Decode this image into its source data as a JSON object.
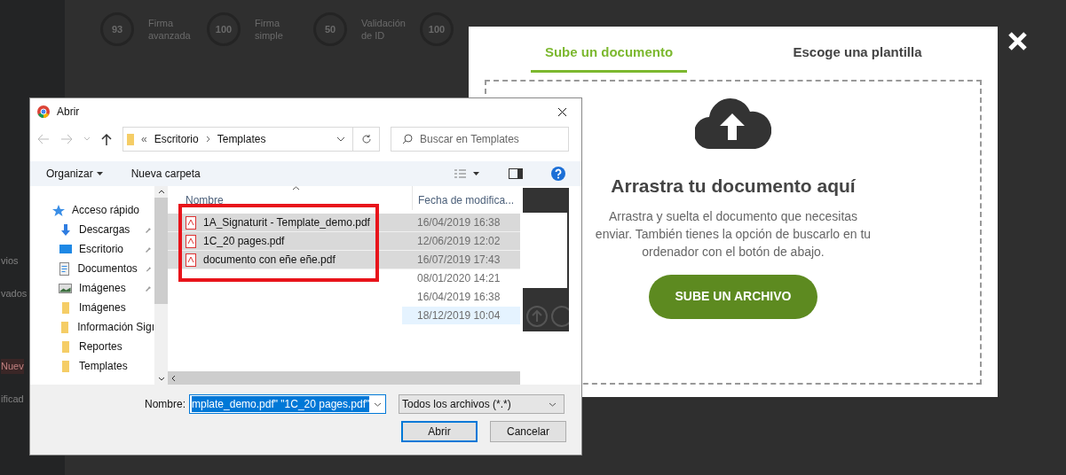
{
  "background": {
    "stats": [
      {
        "value": "93",
        "label": "Firma avanzada"
      },
      {
        "value": "100",
        "label": "Firma simple"
      },
      {
        "value": "50",
        "label": "Validación de ID"
      },
      {
        "value": "100"
      }
    ],
    "sidebar_fragments": [
      {
        "text": "vios",
        "kind": "plain"
      },
      {
        "text": "vados",
        "kind": "plain"
      },
      {
        "text": "Nuev",
        "kind": "badge"
      },
      {
        "text": "ificad",
        "kind": "plain"
      }
    ]
  },
  "dialog": {
    "title": "Abrir",
    "address": {
      "overflow": "«",
      "path": [
        "Escritorio",
        "Templates"
      ]
    },
    "search": {
      "placeholder": "Buscar en Templates"
    },
    "toolbar": {
      "organize": "Organizar",
      "new_folder": "Nueva carpeta"
    },
    "nav_items": [
      {
        "label": "Acceso rápido",
        "kind": "quick_access",
        "pinned": false
      },
      {
        "label": "Descargas",
        "kind": "downloads",
        "pinned": true
      },
      {
        "label": "Escritorio",
        "kind": "desktop",
        "pinned": true
      },
      {
        "label": "Documentos",
        "kind": "documents",
        "pinned": true
      },
      {
        "label": "Imágenes",
        "kind": "pictures",
        "pinned": true
      },
      {
        "label": "Imágenes",
        "kind": "folder",
        "pinned": false
      },
      {
        "label": "Información Sigı",
        "kind": "folder",
        "pinned": false
      },
      {
        "label": "Reportes",
        "kind": "folder",
        "pinned": false
      },
      {
        "label": "Templates",
        "kind": "folder",
        "pinned": false
      }
    ],
    "columns": {
      "name": "Nombre",
      "date": "Fecha de modifica..."
    },
    "files": [
      {
        "name": "1A_Signaturit - Template_demo.pdf",
        "date": "16/04/2019 16:38",
        "selected": true,
        "hovered": false
      },
      {
        "name": "1C_20 pages.pdf",
        "date": "12/06/2019 12:02",
        "selected": true,
        "hovered": false
      },
      {
        "name": "documento con eñe eñe.pdf",
        "date": "16/07/2019 17:43",
        "selected": true,
        "hovered": false
      },
      {
        "date": "08/01/2020 14:21",
        "selected": false,
        "hovered": false
      },
      {
        "date": "16/04/2019 16:38",
        "selected": false,
        "hovered": false
      },
      {
        "date": "18/12/2019 10:04",
        "selected": false,
        "hovered": true
      }
    ],
    "filename_label": "Nombre:",
    "filename_value": "mplate_demo.pdf\" \"1C_20 pages.pdf\"",
    "filter": "Todos los archivos (*.*)",
    "open_button": "Abrir",
    "cancel_button": "Cancelar"
  },
  "upload_modal": {
    "tabs": [
      {
        "label": "Sube un documento",
        "selected": true
      },
      {
        "label": "Escoge una plantilla",
        "selected": false
      }
    ],
    "heading": "Arrastra tu documento aquí",
    "text": "Arrastra y suelta el documento que necesitas enviar. También tienes la opción de buscarlo en tu ordenador con el botón de abajo.",
    "button": "SUBE UN ARCHIVO"
  }
}
